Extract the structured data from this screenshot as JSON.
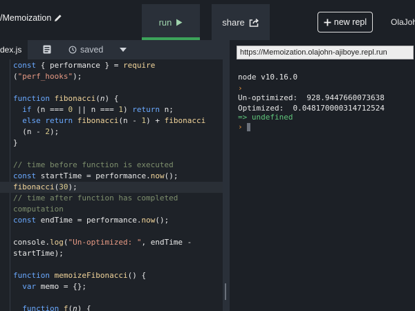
{
  "header": {
    "repl_name": "/Memoization",
    "run_label": "run",
    "share_label": "share",
    "new_repl_label": "new repl",
    "user": "OlaJoh"
  },
  "editor": {
    "file_tab": "dex.js",
    "saved_label": "saved"
  },
  "console": {
    "url": "https://Memoization.olajohn-ajiboye.repl.run",
    "version": "node v10.16.0",
    "unoptimized_label": "Un-optimized:",
    "unoptimized_value": "928.9447660073638",
    "optimized_label": "Optimized:",
    "optimized_value": "0.048170000314712524",
    "result": "=> undefined",
    "prompt_glyph": "›"
  },
  "colors": {
    "accent_green": "#3ca35a",
    "keyword_blue": "#6aa9ff",
    "function_yellow": "#f1d49a",
    "string_orange": "#e79a84",
    "comment_green": "#7e8f6d"
  }
}
